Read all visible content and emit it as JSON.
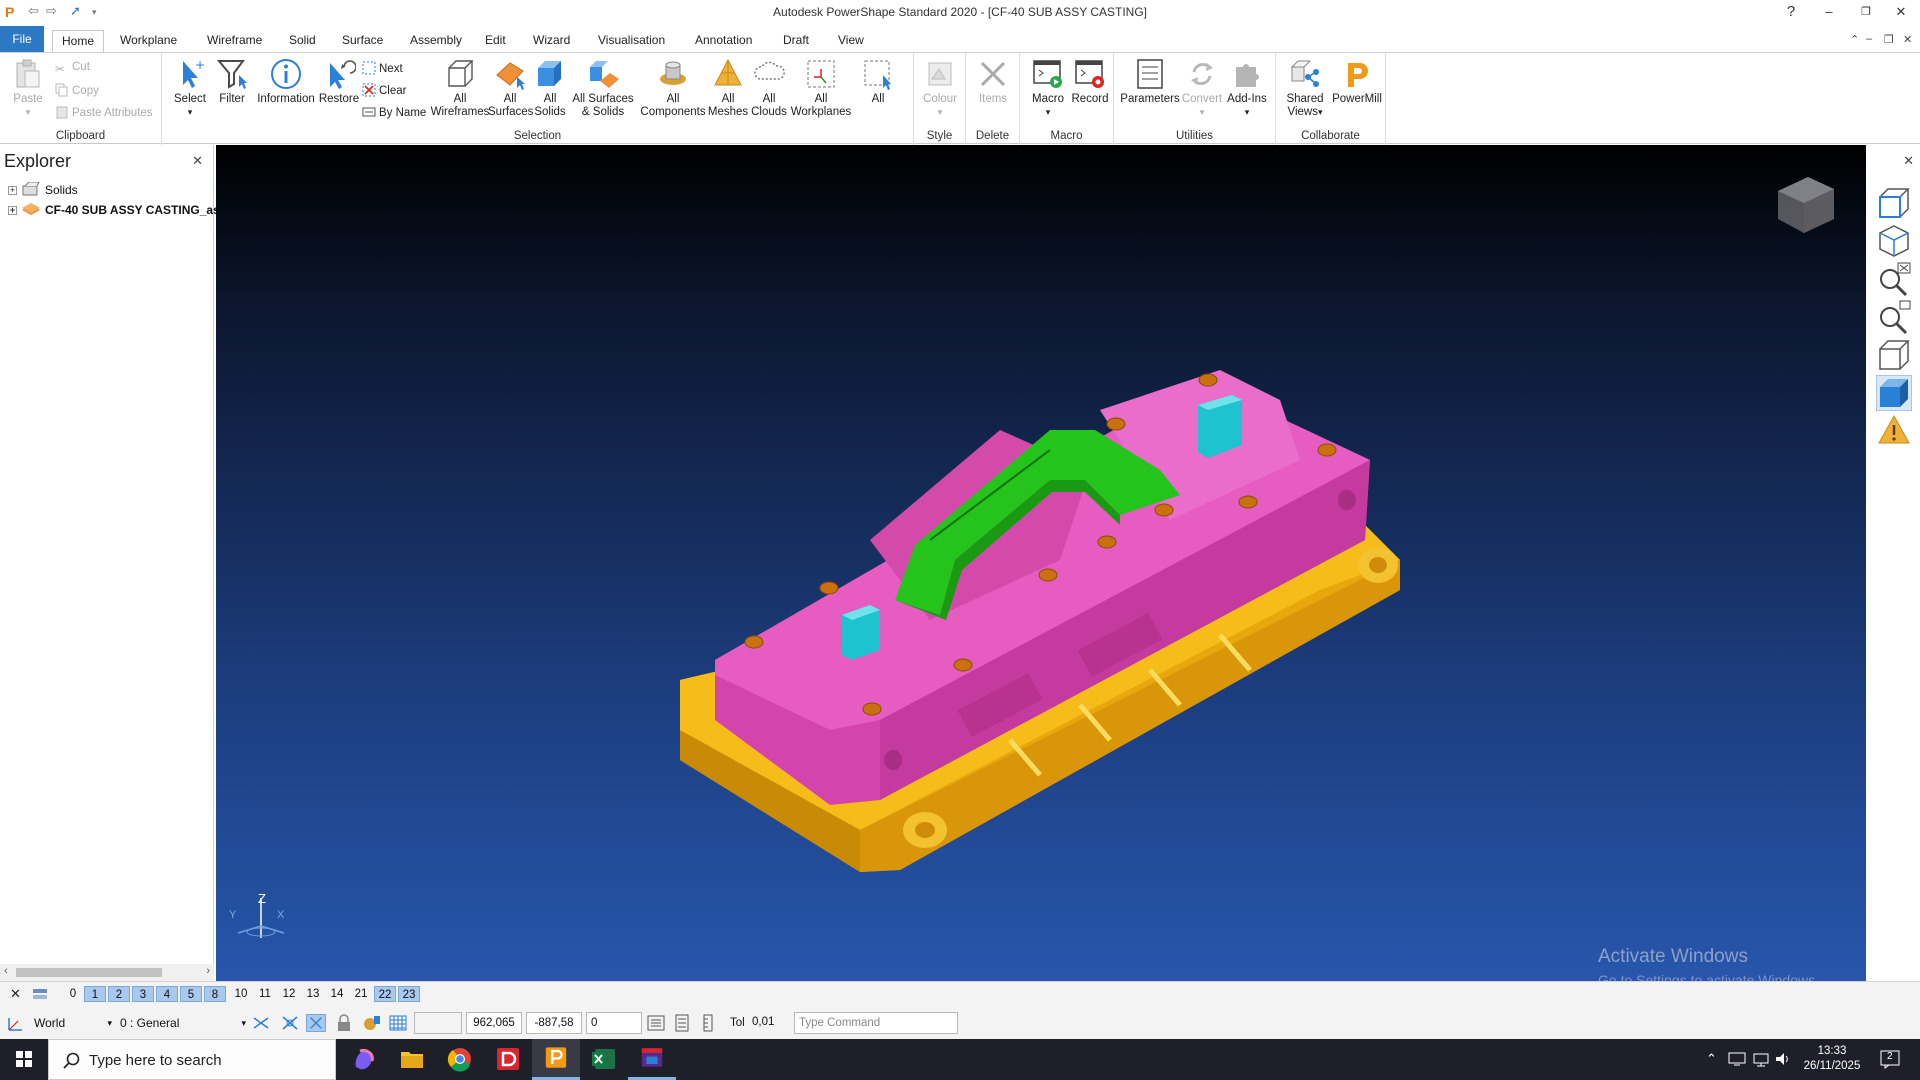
{
  "window": {
    "title": "Autodesk PowerShape Standard 2020 - [CF-40 SUB ASSY CASTING]"
  },
  "tabs": [
    {
      "label": "File"
    },
    {
      "label": "Home"
    },
    {
      "label": "Workplane"
    },
    {
      "label": "Wireframe"
    },
    {
      "label": "Solid"
    },
    {
      "label": "Surface"
    },
    {
      "label": "Assembly"
    },
    {
      "label": "Edit"
    },
    {
      "label": "Wizard"
    },
    {
      "label": "Visualisation"
    },
    {
      "label": "Annotation"
    },
    {
      "label": "Draft"
    },
    {
      "label": "View"
    }
  ],
  "ribbon": {
    "clipboard": {
      "label": "Clipboard",
      "paste": "Paste",
      "cut": "Cut",
      "copy": "Copy",
      "paste_attributes": "Paste Attributes"
    },
    "selection": {
      "label": "Selection",
      "select": "Select",
      "filter": "Filter",
      "information": "Information",
      "restore": "Restore",
      "next": "Next",
      "clear": "Clear",
      "by_name": "By Name",
      "all_wireframes": [
        "All",
        "Wireframes"
      ],
      "all_surfaces": [
        "All",
        "Surfaces"
      ],
      "all_solids": [
        "All",
        "Solids"
      ],
      "all_surfaces_solids": [
        "All Surfaces",
        "& Solids"
      ],
      "all_components": [
        "All",
        "Components"
      ],
      "all_meshes": [
        "All",
        "Meshes"
      ],
      "all_clouds": [
        "All",
        "Clouds"
      ],
      "all_workplanes": [
        "All",
        "Workplanes"
      ],
      "all": "All"
    },
    "style": {
      "label": "Style",
      "colour": "Colour"
    },
    "delete": {
      "label": "Delete",
      "items": "Items"
    },
    "macro": {
      "label": "Macro",
      "macro": "Macro",
      "record": "Record"
    },
    "utilities": {
      "label": "Utilities",
      "parameters": "Parameters",
      "convert": "Convert",
      "addins": "Add-Ins"
    },
    "collaborate": {
      "label": "Collaborate",
      "shared_views": [
        "Shared",
        "Views"
      ],
      "powermill": "PowerMill"
    }
  },
  "explorer": {
    "title": "Explorer",
    "items": [
      {
        "label": "Solids"
      },
      {
        "label": "CF-40 SUB ASSY CASTING_as"
      }
    ]
  },
  "triad": {
    "z": "Z",
    "y": "Y",
    "x": "X"
  },
  "watermark": {
    "line1": "Activate Windows",
    "line2": "Go to Settings to activate Windows."
  },
  "levels": [
    "0",
    "1",
    "2",
    "3",
    "4",
    "5",
    "8",
    "10",
    "11",
    "12",
    "13",
    "14",
    "21",
    "22",
    "23"
  ],
  "levels_on": [
    "1",
    "2",
    "3",
    "4",
    "5",
    "8",
    "22",
    "23"
  ],
  "statusbar": {
    "workplane": "World",
    "level": "0  : General",
    "x": "962,065",
    "y": "-887,58",
    "z": "0",
    "tol_label": "Tol",
    "tol_value": "0,01",
    "command_placeholder": "Type Command"
  },
  "taskbar": {
    "search_placeholder": "Type here to search",
    "time": "13:33",
    "date": "26/11/2025",
    "notifications": "2"
  },
  "colors": {
    "file_tab": "#2b78c5",
    "casting_magenta": "#e24fb9",
    "base_yellow": "#f0b10c",
    "green_part": "#22c81a",
    "cyan_blocks": "#1ec3d0",
    "bolts": "#c9700f"
  }
}
